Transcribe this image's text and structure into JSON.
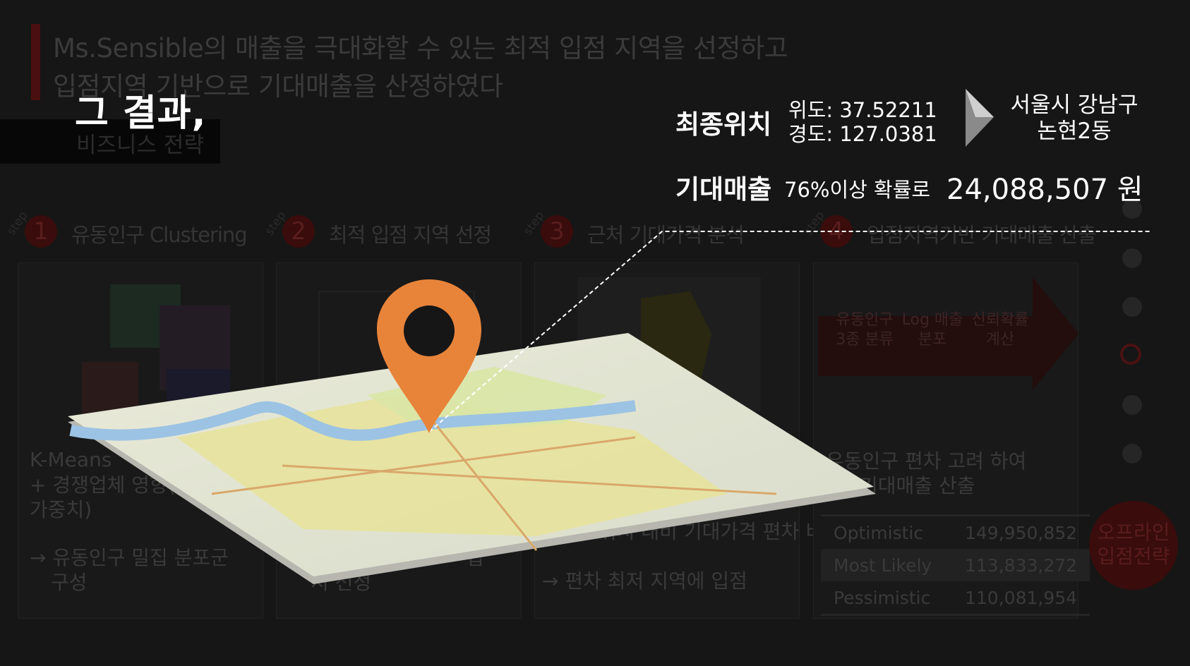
{
  "header": {
    "line1": "Ms.Sensible의 매출을 극대화할 수 있는 최적 입점 지역을 선정하고",
    "line2": "입점지역 기반으로 기대매출을 산정하였다",
    "section": "비즈니스 전략"
  },
  "result_title": "그 결과,",
  "steps": [
    {
      "word": "step",
      "num": "1",
      "title": "유동인구 Clustering"
    },
    {
      "word": "step",
      "num": "2",
      "title": "최적 입점 지역 선정"
    },
    {
      "word": "step",
      "num": "3",
      "title": "근처 기대가격 분석"
    },
    {
      "word": "step",
      "num": "4",
      "title": "입점지역기반 기대매출 산출"
    }
  ],
  "card1": {
    "line1": "K-Means",
    "line2": "+ 경쟁업체 영향(",
    "line3": "가중치)",
    "line4": "→ 유동인구 밀집 분포군",
    "line5": "구성"
  },
  "card2": {
    "line1": "입",
    "line2": "지 선정"
  },
  "card3": {
    "line1": "위치 대비 기대가격 편차 비교",
    "line2": "→ 편차 최저 지역에 입점"
  },
  "card4": {
    "arrow_items": [
      "유동인구 3종 분류",
      "Log 매출 분포",
      "신뢰확률 계산"
    ],
    "desc1": "유동인구 편차 고려 하여",
    "desc2": "기대매출 산출",
    "scenarios": [
      {
        "name": "Optimistic",
        "value": "149,950,852"
      },
      {
        "name": "Most Likely",
        "value": "113,833,272"
      },
      {
        "name": "Pessimistic",
        "value": "110,081,954"
      }
    ]
  },
  "result": {
    "final_label": "최종위치",
    "lat": "위도: 37.52211",
    "lng": "경도: 127.0381",
    "addr1": "서울시 강남구",
    "addr2": "논현2동",
    "revenue_label": "기대매출",
    "probability": "76%이상  확률로",
    "amount": "24,088,507 원"
  },
  "side_badge": {
    "line1": "오프라인",
    "line2": "입점전략"
  },
  "colors": {
    "pin": "#E8843A",
    "accent_dark": "#3a0c0c",
    "background": "#161616"
  },
  "icons": [
    "map-pin-icon",
    "chevron-right-icon"
  ]
}
